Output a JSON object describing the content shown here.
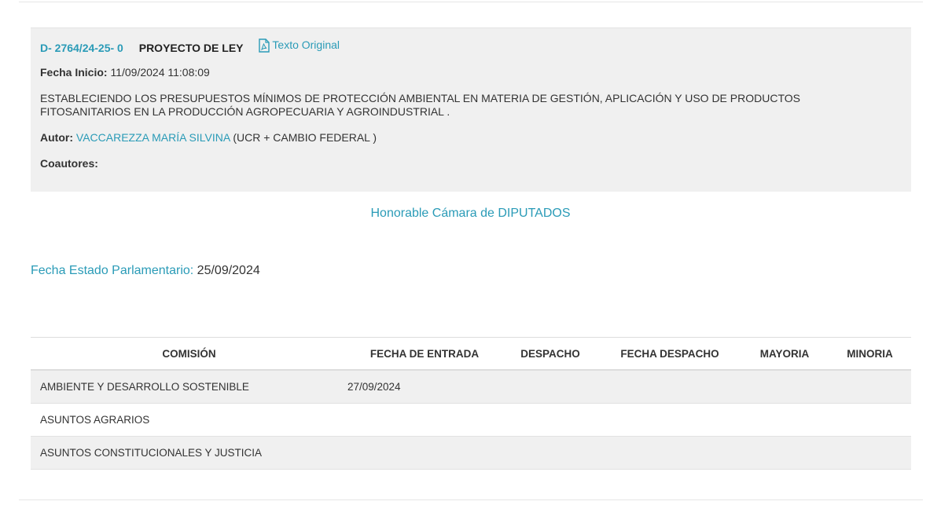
{
  "expediente": {
    "id": "D- 2764/24-25- 0",
    "type": "PROYECTO DE LEY",
    "pdf_link_label": "Texto Original",
    "fecha_inicio_label": "Fecha Inicio:",
    "fecha_inicio_value": "11/09/2024 11:08:09",
    "summary": "ESTABLECIENDO LOS PRESUPUESTOS MÍNIMOS DE PROTECCIÓN AMBIENTAL EN MATERIA DE GESTIÓN, APLICACIÓN Y USO DE PRODUCTOS FITOSANITARIOS EN LA PRODUCCIÓN AGROPECUARIA Y AGROINDUSTRIAL .",
    "autor_label": "Autor:",
    "autor_name": "VACCAREZZA MARÍA SILVINA",
    "autor_party": "(UCR + CAMBIO FEDERAL )",
    "coautores_label": "Coautores:"
  },
  "chamber": "Honorable Cámara de DIPUTADOS",
  "estado": {
    "label": "Fecha Estado Parlamentario:",
    "value": "25/09/2024"
  },
  "table": {
    "headers": [
      "COMISIÓN",
      "FECHA DE ENTRADA",
      "DESPACHO",
      "FECHA DESPACHO",
      "MAYORIA",
      "MINORIA"
    ],
    "rows": [
      [
        "AMBIENTE Y DESARROLLO SOSTENIBLE",
        "27/09/2024",
        "",
        "",
        "",
        ""
      ],
      [
        "ASUNTOS AGRARIOS",
        "",
        "",
        "",
        "",
        ""
      ],
      [
        "ASUNTOS CONSTITUCIONALES Y JUSTICIA",
        "",
        "",
        "",
        "",
        ""
      ]
    ]
  },
  "colors": {
    "accent": "#2a9bb7",
    "card_bg": "#f0f0f0",
    "text": "#333333"
  },
  "icons": {
    "pdf": "pdf-file-icon"
  }
}
